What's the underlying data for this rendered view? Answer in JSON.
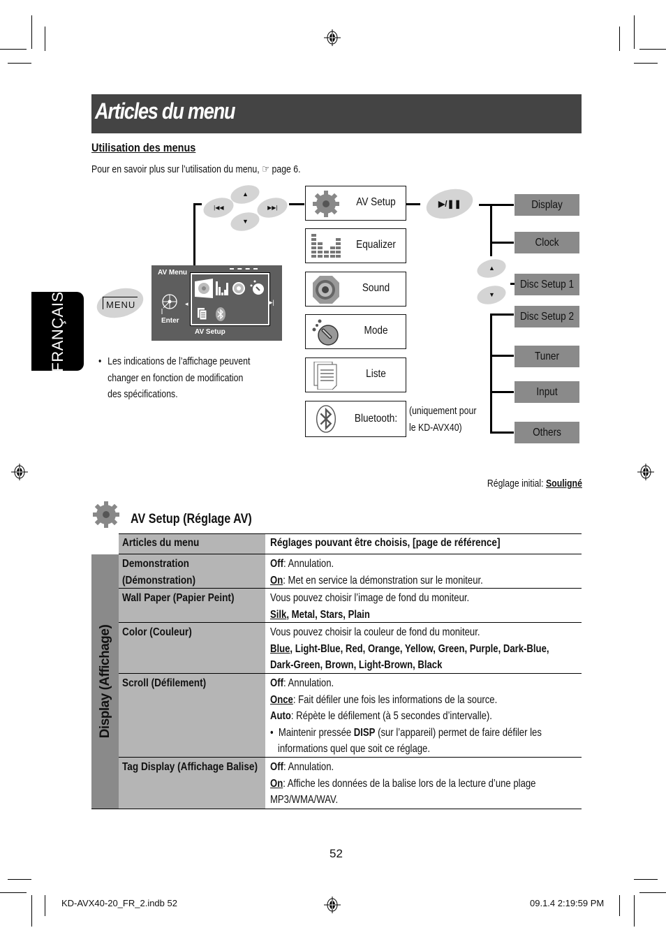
{
  "header": {
    "title": "Articles du menu"
  },
  "usage": {
    "heading": "Utilisation des menus",
    "intro": "Pour en savoir plus sur l’utilisation du menu, ☞ page 6."
  },
  "side_tab": {
    "label": "FRANÇAIS"
  },
  "diagram": {
    "buttons": {
      "menu": "MENU",
      "prev": "|◀◀",
      "next": "▶▶|",
      "up": "▲",
      "down": "▼",
      "play_pause": "▶/❚❚"
    },
    "screen": {
      "title": "AV Menu",
      "enter_label": "Enter",
      "selected_label": "AV Setup"
    },
    "menu_items": [
      {
        "label": "AV Setup",
        "icon": "gear-icon"
      },
      {
        "label": "Equalizer",
        "icon": "equalizer-icon"
      },
      {
        "label": "Sound",
        "icon": "speaker-icon"
      },
      {
        "label": "Mode",
        "icon": "dial-icon"
      },
      {
        "label": "Liste",
        "icon": "list-icon"
      },
      {
        "label": "Bluetooth:",
        "icon": "bluetooth-icon"
      }
    ],
    "bluetooth_note_line1": "(uniquement pour",
    "bluetooth_note_line2": "le KD-AVX40)",
    "submenu_items": [
      {
        "label": "Display"
      },
      {
        "label": "Clock"
      },
      {
        "label": "Disc Setup 1"
      },
      {
        "label": "Disc Setup 2"
      },
      {
        "label": "Tuner"
      },
      {
        "label": "Input"
      },
      {
        "label": "Others"
      }
    ],
    "note": {
      "bullet": "•",
      "text": "Les indications de l’affichage peuvent changer en fonction de modification des spécifications."
    }
  },
  "initial_setting": {
    "label": "Réglage initial:",
    "value": "Souligné"
  },
  "section": {
    "title": "AV Setup (Réglage AV)",
    "icon": "gear-icon"
  },
  "table": {
    "headers": [
      "Articles du menu",
      "Réglages pouvant être choisis, [page de référence]"
    ],
    "group_label": "Display (Affichage)",
    "rows": [
      {
        "item": "Demonstration (Démonstration)",
        "lines": [
          [
            {
              "t": "Off",
              "style": "b"
            },
            {
              "t": ": Annulation.",
              "style": ""
            }
          ],
          [
            {
              "t": "On",
              "style": "u"
            },
            {
              "t": ": Met en service la démonstration sur le moniteur.",
              "style": ""
            }
          ]
        ]
      },
      {
        "item": "Wall Paper (Papier Peint)",
        "lines": [
          [
            {
              "t": "Vous pouvez choisir l’image de fond du moniteur.",
              "style": ""
            }
          ],
          [
            {
              "t": "Silk",
              "style": "u"
            },
            {
              "t": ", Metal, Stars, Plain",
              "style": "b"
            }
          ]
        ]
      },
      {
        "item": "Color (Couleur)",
        "lines": [
          [
            {
              "t": "Vous pouvez choisir la couleur de fond du moniteur.",
              "style": ""
            }
          ],
          [
            {
              "t": "Blue",
              "style": "u"
            },
            {
              "t": ", Light-Blue, Red, Orange, Yellow, Green, Purple, Dark-Blue,",
              "style": "b"
            }
          ],
          [
            {
              "t": "Dark-Green, Brown, Light-Brown, Black",
              "style": "b"
            }
          ]
        ]
      },
      {
        "item": "Scroll (Défilement)",
        "lines": [
          [
            {
              "t": "Off",
              "style": "b"
            },
            {
              "t": ": Annulation.",
              "style": ""
            }
          ],
          [
            {
              "t": "Once",
              "style": "u"
            },
            {
              "t": ": Fait défiler une fois les informations de la source.",
              "style": ""
            }
          ],
          [
            {
              "t": "Auto",
              "style": "b"
            },
            {
              "t": ": Répète le défilement (à 5 secondes d’intervalle).",
              "style": ""
            }
          ],
          [
            {
              "t": "•  Maintenir pressée ",
              "style": ""
            },
            {
              "t": "DISP",
              "style": "b"
            },
            {
              "t": " (sur l’appareil) permet de faire défiler les",
              "style": ""
            }
          ],
          [
            {
              "t": "   informations quel que soit ce réglage.",
              "style": ""
            }
          ]
        ]
      },
      {
        "item": "Tag Display (Affichage Balise)",
        "lines": [
          [
            {
              "t": "Off",
              "style": "b"
            },
            {
              "t": ": Annulation.",
              "style": ""
            }
          ],
          [
            {
              "t": "On",
              "style": "u"
            },
            {
              "t": ": Affiche les données de la balise lors de la lecture d’une plage",
              "style": ""
            }
          ],
          [
            {
              "t": "MP3/WMA/WAV.",
              "style": ""
            }
          ]
        ]
      }
    ]
  },
  "footer": {
    "page_number": "52",
    "file": "KD-AVX40-20_FR_2.indb   52",
    "timestamp": "09.1.4   2:19:59 PM"
  }
}
